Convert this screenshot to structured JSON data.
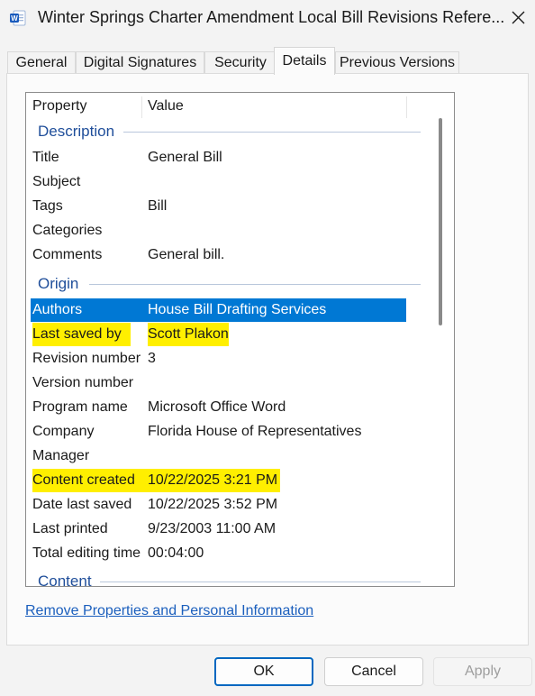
{
  "window": {
    "title": "Winter Springs Charter Amendment Local Bill Revisions Refere...",
    "app_icon": "word-document-icon",
    "close_icon": "close-icon"
  },
  "tabs": [
    {
      "label": "General",
      "active": false
    },
    {
      "label": "Digital Signatures",
      "active": false
    },
    {
      "label": "Security",
      "active": false
    },
    {
      "label": "Details",
      "active": true
    },
    {
      "label": "Previous Versions",
      "active": false
    }
  ],
  "details": {
    "columns": {
      "property": "Property",
      "value": "Value"
    },
    "groups": {
      "description": "Description",
      "origin": "Origin",
      "content": "Content"
    },
    "rows": [
      {
        "property": "Title",
        "value": "General Bill"
      },
      {
        "property": "Subject",
        "value": ""
      },
      {
        "property": "Tags",
        "value": "Bill"
      },
      {
        "property": "Categories",
        "value": ""
      },
      {
        "property": "Comments",
        "value": "General bill."
      },
      {
        "property": "Authors",
        "value": "House Bill Drafting Services",
        "selected": true
      },
      {
        "property": "Last saved by",
        "value": "Scott Plakon",
        "highlight": "#ffef00"
      },
      {
        "property": "Revision number",
        "value": "3"
      },
      {
        "property": "Version number",
        "value": ""
      },
      {
        "property": "Program name",
        "value": "Microsoft Office Word"
      },
      {
        "property": "Company",
        "value": "Florida House of Representatives"
      },
      {
        "property": "Manager",
        "value": ""
      },
      {
        "property": "Content created",
        "value": "10/22/2025 3:21 PM",
        "highlight": "#ffef00"
      },
      {
        "property": "Date last saved",
        "value": "10/22/2025 3:52 PM"
      },
      {
        "property": "Last printed",
        "value": "9/23/2003 11:00 AM"
      },
      {
        "property": "Total editing time",
        "value": "00:04:00"
      }
    ]
  },
  "remove_link": "Remove Properties and Personal Information",
  "buttons": {
    "ok": "OK",
    "cancel": "Cancel",
    "apply": "Apply"
  },
  "colors": {
    "selection": "#0078d4",
    "highlight": "#ffef00",
    "group_text": "#1f4e9a",
    "link": "#1b5fbd"
  }
}
